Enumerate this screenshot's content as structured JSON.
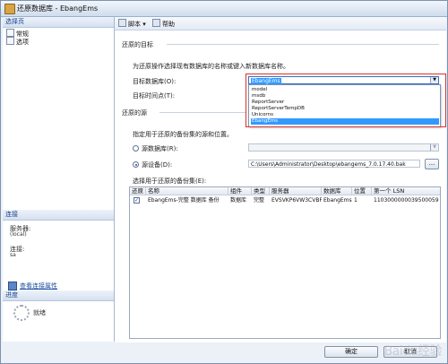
{
  "window": {
    "title": "还原数据库 - EbangEms"
  },
  "sidebar": {
    "header": "选择页",
    "items": [
      {
        "label": "常规"
      },
      {
        "label": "选项"
      }
    ],
    "connection": {
      "header": "连接",
      "server_label": "服务器:",
      "server_value": "(local)",
      "conn_label": "连接:",
      "conn_value": "sa",
      "view_props_link": "查看连接属性"
    },
    "progress": {
      "header": "进度",
      "status": "就绪"
    }
  },
  "toolbar": {
    "script_label": "脚本",
    "help_label": "帮助"
  },
  "restore_target": {
    "section_title": "还原的目标",
    "description": "为还原操作选择现有数据库的名称或键入新数据库名称。",
    "target_db_label": "目标数据库(O):",
    "target_db_value": "EbangEms",
    "target_time_label": "目标时间点(T):",
    "dropdown_options": [
      "model",
      "msdb",
      "ReportServer",
      "ReportServerTempDB",
      "Unicorns",
      "EbangEms"
    ],
    "dropdown_selected": "EbangEms"
  },
  "restore_source": {
    "section_title": "还原的源",
    "description": "指定用于还原的备份集的源和位置。",
    "source_db_label": "源数据库(R):",
    "source_device_label": "源设备(D):",
    "source_device_path": "C:\\Users\\Administrator\\Desktop\\ebangems_7.0.17.40.bak",
    "browse_label": "..."
  },
  "backup_sets": {
    "title": "选择用于还原的备份集(E):",
    "columns": [
      "还原",
      "名称",
      "组件",
      "类型",
      "服务器",
      "数据库",
      "位置",
      "第一个 LSN"
    ],
    "rows": [
      {
        "restore": true,
        "name": "EbangEms-完整 数据库 备份",
        "component": "数据库",
        "type": "完整",
        "server": "EVSVKP6VW3CVBFI",
        "database": "EbangEms",
        "position": "1",
        "first_lsn": "1103000000039500059"
      }
    ]
  },
  "buttons": {
    "ok_label": "确定",
    "cancel_label": "取消"
  },
  "watermark": "Baidu经验",
  "colors": {
    "selection": "#3399ff",
    "highlight_box": "#d6322c",
    "accent": "#15428b"
  }
}
